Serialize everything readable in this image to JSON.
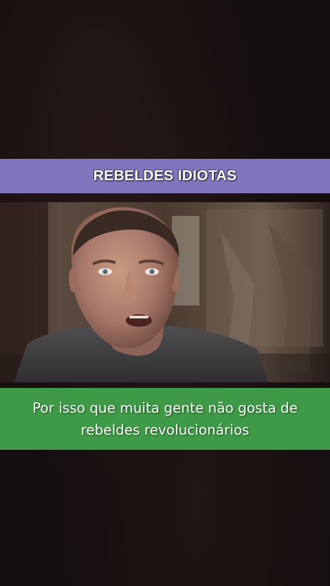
{
  "header": {
    "title": "REBELDES IDIOTAS"
  },
  "video": {
    "subject": "man-speaking"
  },
  "caption": {
    "text": "Por isso que muita gente não gosta de rebeldes revolucionários"
  },
  "colors": {
    "background": "#140e0e",
    "title_bar": "#7f76bd",
    "caption_bar": "#3e9a46",
    "text": "#ffffff"
  }
}
